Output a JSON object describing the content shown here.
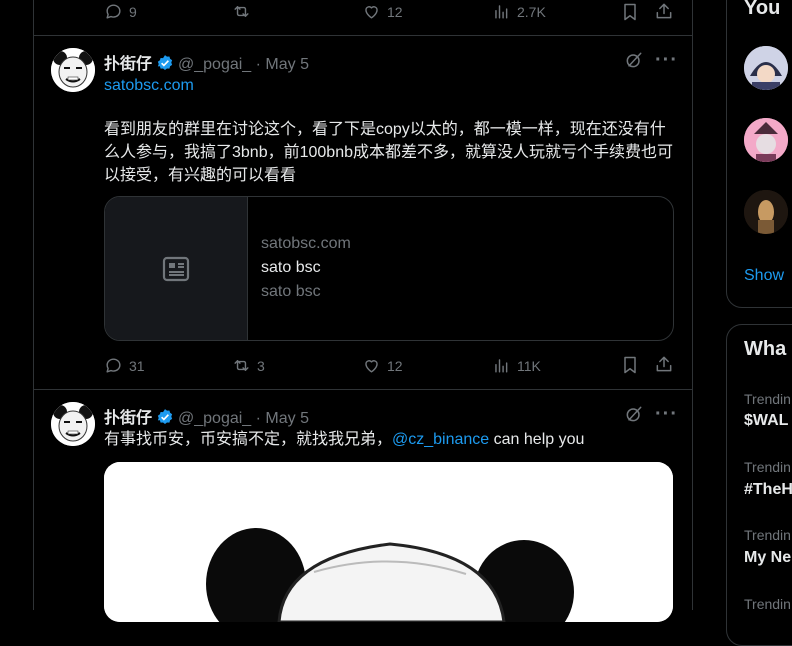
{
  "top_actions": {
    "replies": "9",
    "views": "2.7K",
    "likes": "12"
  },
  "tweet1": {
    "author_name": "扑街仔",
    "handle": "@_pogai_",
    "date": "· May 5",
    "link": "satobsc.com",
    "text": "看到朋友的群里在讨论这个，看了下是copy以太的，都一模一样，现在还没有什么人参与，我搞了3bnb，前100bnb成本都差不多，就算没人玩就亏个手续费也可以接受，有兴趣的可以看看",
    "card": {
      "domain": "satobsc.com",
      "title": "sato bsc",
      "description": "sato bsc"
    },
    "actions": {
      "replies": "31",
      "reposts": "3",
      "likes": "12",
      "views": "11K"
    }
  },
  "tweet2": {
    "author_name": "扑街仔",
    "handle": "@_pogai_",
    "date": "· May 5",
    "text_before": "有事找币安，币安搞不定，就找我兄弟，",
    "mention": "@cz_binance",
    "text_after": " can help you"
  },
  "sidebar": {
    "who_to_follow_title": "You",
    "show_more": "Show",
    "whats_happening_title": "Wha",
    "trends": [
      {
        "label": "Trendin",
        "name": "$WAL"
      },
      {
        "label": "Trendin",
        "name": "#TheH"
      },
      {
        "label": "Trendin",
        "name": "My Ne"
      },
      {
        "label": "Trendin",
        "name": ""
      }
    ]
  },
  "colors": {
    "accent": "#1d9bf0",
    "muted": "#71767b",
    "border": "#2f3336",
    "text": "#e7e9ea"
  }
}
